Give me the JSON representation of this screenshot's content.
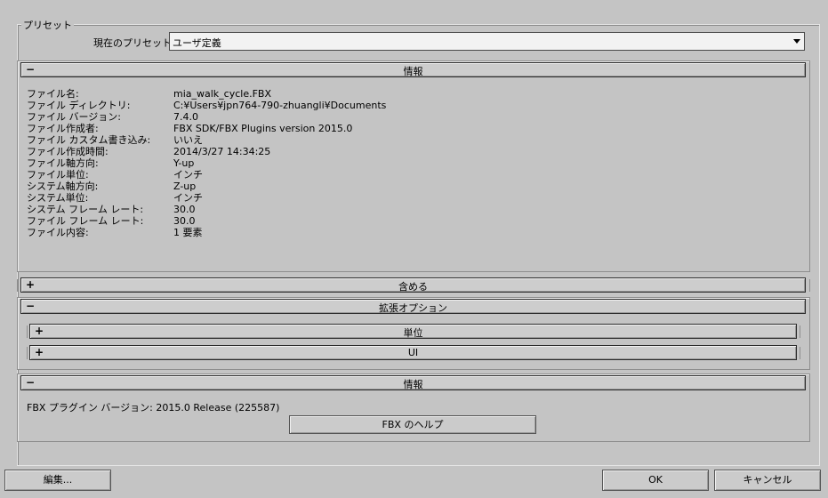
{
  "preset": {
    "group_label": "プリセット",
    "current_label": "現在のプリセット:",
    "current_value": "ユーザ定義"
  },
  "info_section": {
    "title": "情報",
    "sign": "−",
    "rows": [
      {
        "label": "ファイル名:",
        "value": "mia_walk_cycle.FBX"
      },
      {
        "label": "ファイル ディレクトリ:",
        "value": "C:¥Users¥jpn764-790-zhuangli¥Documents"
      },
      {
        "label": "ファイル バージョン:",
        "value": "7.4.0"
      },
      {
        "label": "ファイル作成者:",
        "value": "FBX SDK/FBX Plugins version 2015.0"
      },
      {
        "label": "ファイル カスタム書き込み:",
        "value": "いいえ"
      },
      {
        "label": "ファイル作成時間:",
        "value": "2014/3/27  14:34:25"
      },
      {
        "label": "ファイル軸方向:",
        "value": "Y-up"
      },
      {
        "label": "ファイル単位:",
        "value": "インチ"
      },
      {
        "label": "システム軸方向:",
        "value": "Z-up"
      },
      {
        "label": "システム単位:",
        "value": "インチ"
      },
      {
        "label": "システム フレーム レート:",
        "value": "30.0"
      },
      {
        "label": "ファイル フレーム レート:",
        "value": "30.0"
      },
      {
        "label": "ファイル内容:",
        "value": "1 要素"
      }
    ]
  },
  "include_section": {
    "title": "含める",
    "sign": "+"
  },
  "extended_section": {
    "title": "拡張オプション",
    "sign": "−",
    "units": {
      "title": "単位",
      "sign": "+"
    },
    "ui": {
      "title": "UI",
      "sign": "+"
    }
  },
  "info2_section": {
    "title": "情報",
    "sign": "−",
    "plugin_version": "FBX プラグイン バージョン: 2015.0 Release (225587)",
    "help_button": "FBX のヘルプ"
  },
  "footer": {
    "edit_button": "編集...",
    "ok_button": "OK",
    "cancel_button": "キャンセル"
  }
}
